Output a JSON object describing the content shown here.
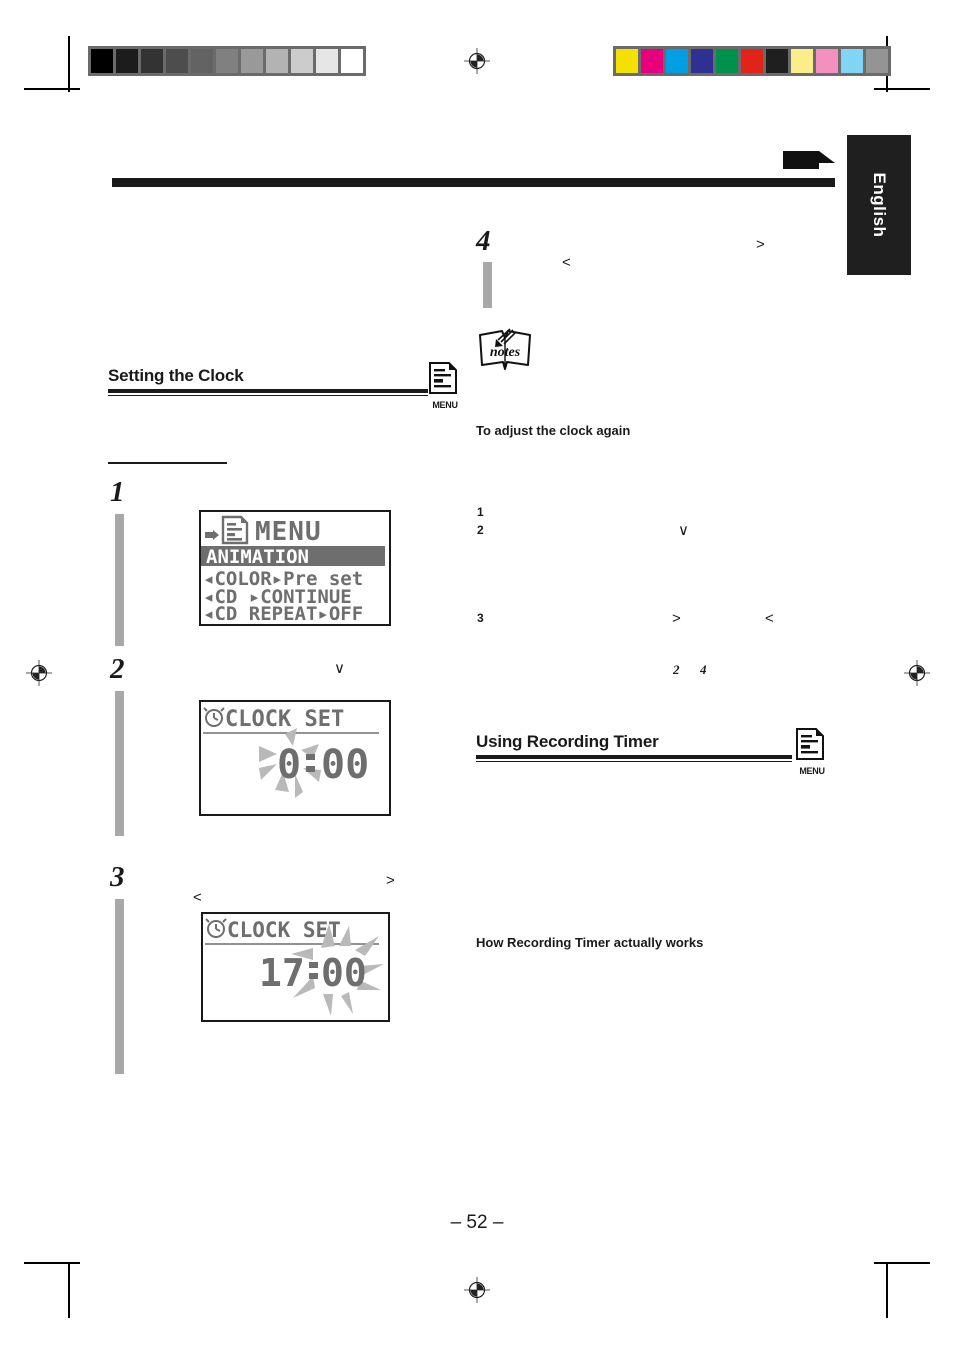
{
  "page": {
    "number_label": "– 52 –",
    "language_tab": "English"
  },
  "calibration": {
    "grayscale_swatches": [
      "#000000",
      "#1c1c1c",
      "#333333",
      "#4d4d4d",
      "#636363",
      "#808080",
      "#999999",
      "#b3b3b3",
      "#cccccc",
      "#e6e6e6",
      "#ffffff"
    ],
    "color_swatches": [
      "#f5e100",
      "#e6007e",
      "#009fe3",
      "#2e3191",
      "#00924b",
      "#e2231a",
      "#1f1f1f",
      "#faee8c",
      "#f490c0",
      "#82d4f5",
      "#949494"
    ]
  },
  "sections": [
    {
      "id": "setting-the-clock",
      "title": "Setting the Clock",
      "menu_icon_caption": "MENU"
    },
    {
      "id": "using-recording-timer",
      "title": "Using Recording Timer",
      "menu_icon_caption": "MENU"
    }
  ],
  "left_column": {
    "steps": [
      {
        "number": "1"
      },
      {
        "number": "2"
      },
      {
        "number": "3"
      }
    ]
  },
  "right_column": {
    "step4_number": "4",
    "notes_icon_label": "notes",
    "sub_headings": [
      "To adjust the clock again",
      "How Recording Timer actually works"
    ],
    "numbered_items": [
      "1",
      "2",
      "3"
    ],
    "italic_refs": [
      "2",
      "4"
    ],
    "nav_glyphs": [
      ">",
      "<",
      "∨",
      ">",
      "<"
    ]
  },
  "lcd_displays": [
    {
      "id": "menu-screen",
      "title": "MENU",
      "rows": [
        {
          "text": "ANIMATION",
          "highlighted": true
        },
        {
          "text": "◀COLOR▶Pre set",
          "highlighted": false
        },
        {
          "text": "◀CD ▶CONTINUE",
          "highlighted": false
        },
        {
          "text": "◀CD REPEAT▶OFF",
          "highlighted": false
        }
      ]
    },
    {
      "id": "clock-set-hour",
      "title": "CLOCK SET",
      "hours": "0",
      "minutes": "00",
      "separator": ":",
      "flashing_field": "hours"
    },
    {
      "id": "clock-set-minute",
      "title": "CLOCK SET",
      "hours": "17",
      "minutes": "00",
      "separator": ":",
      "flashing_field": "minutes"
    }
  ],
  "colors": {
    "ink": "#1a1a1a",
    "lcd_pixel": "#6e6e6e",
    "lcd_pixel_light": "#b9b9b9",
    "step_bar": "#a8a8a8",
    "tab_bg": "#1f1f1f"
  }
}
